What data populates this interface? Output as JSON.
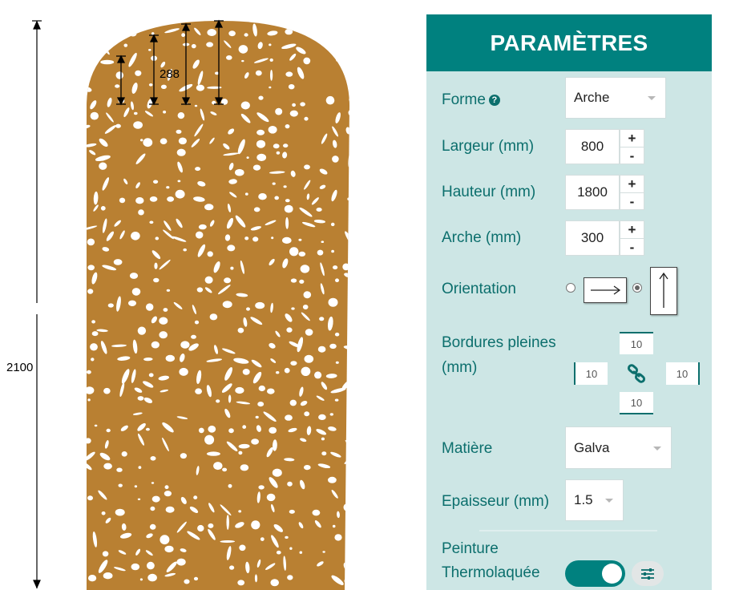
{
  "preview": {
    "height_label": "2100",
    "arch_label": "288",
    "panel_color": "#b98032",
    "icons": [
      "dimension-arrow-icon"
    ]
  },
  "panel": {
    "title": "PARAMÈTRES",
    "header_color": "#00817f",
    "background_color": "#cde6e5",
    "label_color": "#0c6f6d",
    "forme": {
      "label": "Forme",
      "help_icon": "?",
      "value": "Arche"
    },
    "largeur": {
      "label": "Largeur (mm)",
      "value": "800"
    },
    "hauteur": {
      "label": "Hauteur (mm)",
      "value": "1800"
    },
    "arche": {
      "label": "Arche (mm)",
      "value": "300"
    },
    "stepper": {
      "plus": "+",
      "minus": "-"
    },
    "orientation": {
      "label": "Orientation",
      "options": [
        "horizontal",
        "vertical"
      ],
      "selected": "vertical",
      "icons": [
        "arrow-right-icon",
        "arrow-up-icon"
      ]
    },
    "bordures": {
      "label_line1": "Bordures pleines",
      "label_line2": "(mm)",
      "top": "10",
      "left": "10",
      "right": "10",
      "bottom": "10",
      "icon": "link-icon"
    },
    "matiere": {
      "label": "Matière",
      "value": "Galva"
    },
    "epaisseur": {
      "label": "Epaisseur (mm)",
      "value": "1.5"
    },
    "peinture": {
      "label_line1": "Peinture",
      "label_line2": "Thermolaquée",
      "enabled": true,
      "icons": [
        "sliders-icon"
      ]
    }
  }
}
